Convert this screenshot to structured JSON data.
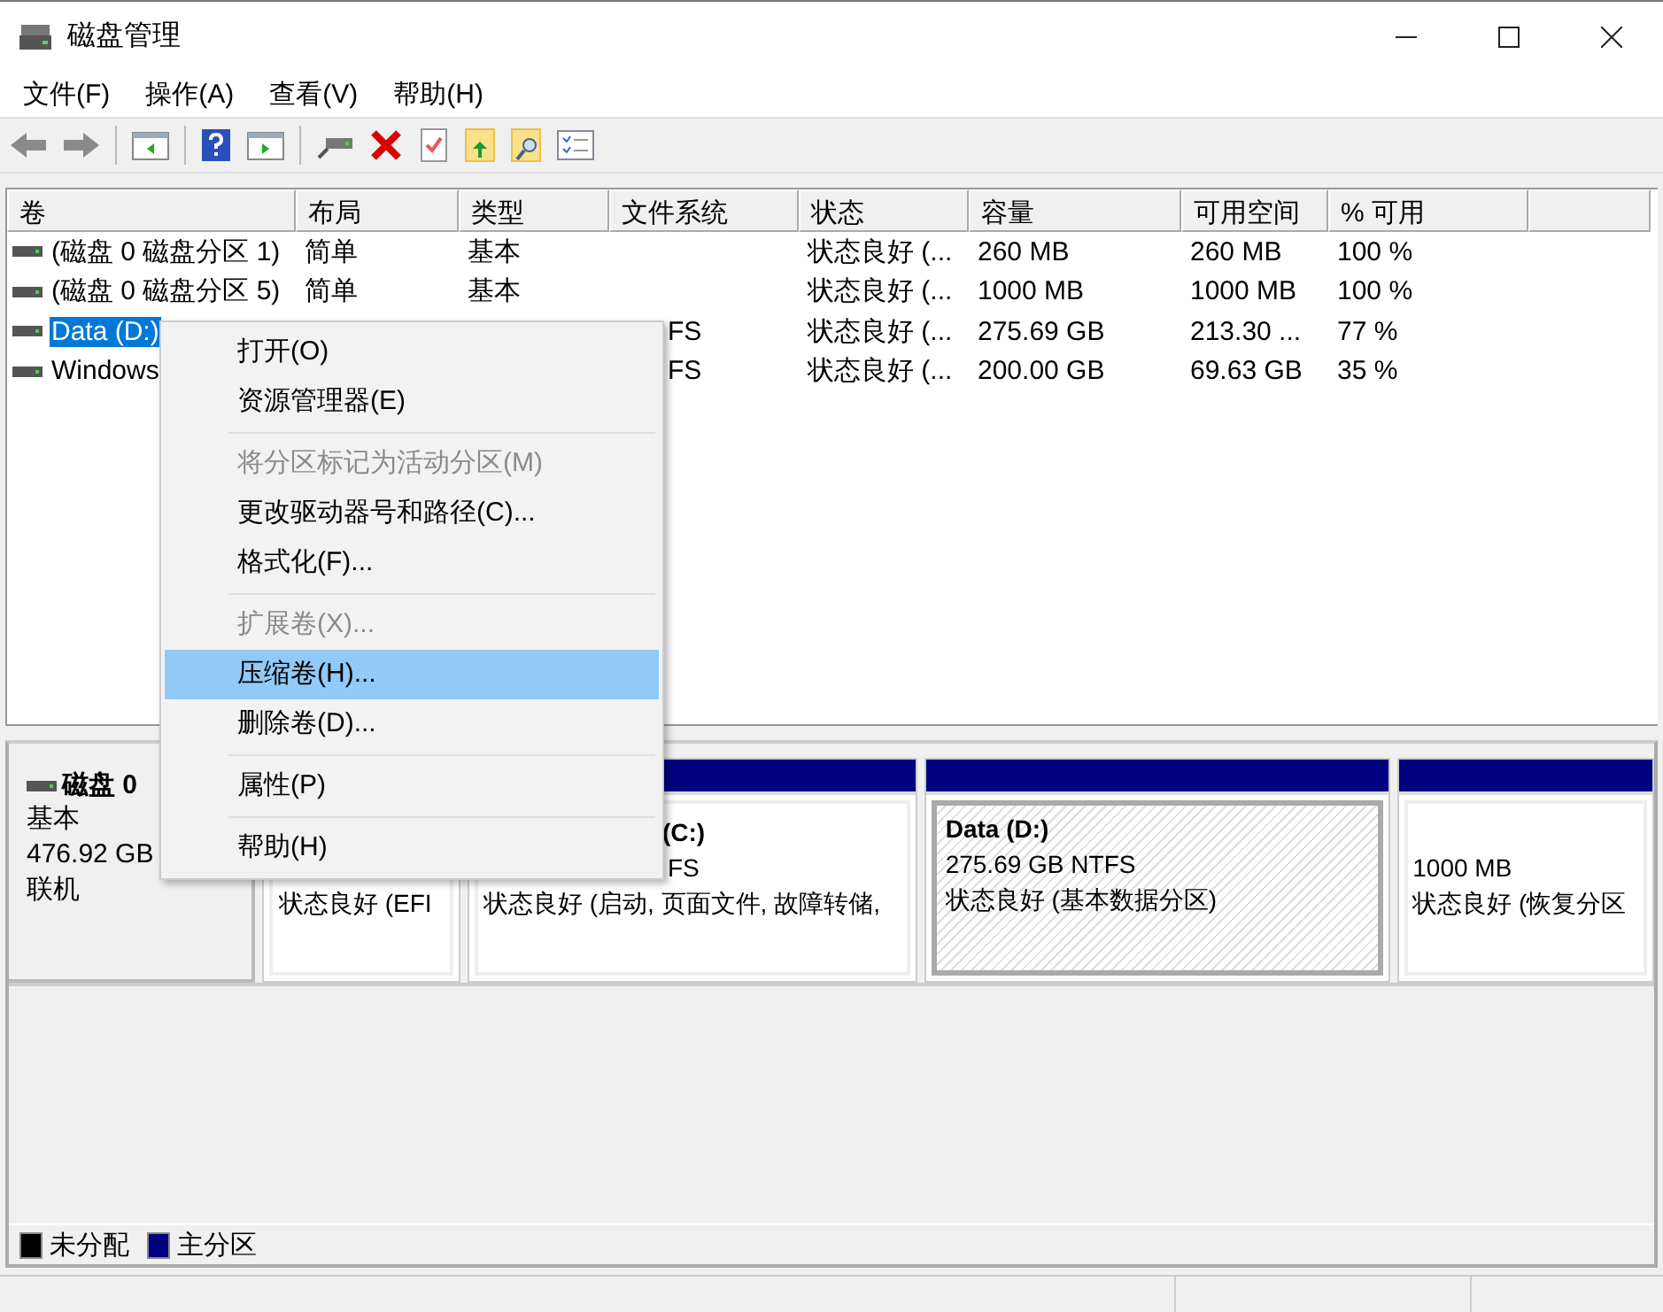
{
  "window": {
    "title": "磁盘管理"
  },
  "menu_bar": [
    "文件(F)",
    "操作(A)",
    "查看(V)",
    "帮助(H)"
  ],
  "table": {
    "columns": [
      "卷",
      "布局",
      "类型",
      "文件系统",
      "状态",
      "容量",
      "可用空间",
      "% 可用"
    ],
    "rows": [
      {
        "volume": "(磁盘 0 磁盘分区 1)",
        "layout": "简单",
        "type": "基本",
        "status": "状态良好 (...",
        "capacity": "260 MB",
        "free_space": "260 MB",
        "percent_free": "100 %",
        "selected": false
      },
      {
        "volume": "(磁盘 0 磁盘分区 5)",
        "layout": "简单",
        "type": "基本",
        "status": "状态良好 (...",
        "capacity": "1000 MB",
        "free_space": "1000 MB",
        "percent_free": "100 %",
        "selected": false
      },
      {
        "volume": "Data (D:)",
        "filesystem": "FS",
        "filesystem_cut": true,
        "status": "状态良好 (...",
        "capacity": "275.69 GB",
        "free_space": "213.30 ...",
        "percent_free": "77 %",
        "selected": true
      },
      {
        "volume": "Windows",
        "filesystem": "FS",
        "filesystem_cut": true,
        "status": "状态良好 (...",
        "capacity": "200.00 GB",
        "free_space": "69.63 GB",
        "percent_free": "35 %",
        "selected": false
      }
    ]
  },
  "disk": {
    "name": "磁盘 0",
    "type": "基本",
    "size": "476.92 GB",
    "state": "联机",
    "partitions": [
      {
        "status": "状态良好 (EFI",
        "selected": false
      },
      {
        "title": "(C:)",
        "size": "FS",
        "status": "状态良好 (启动, 页面文件, 故障转储,",
        "cut": true,
        "selected": false
      },
      {
        "title": "Data  (D:)",
        "size": "275.69 GB NTFS",
        "status": "状态良好 (基本数据分区)",
        "selected": true
      },
      {
        "size": "1000 MB",
        "status": "状态良好 (恢复分区",
        "selected": false
      }
    ]
  },
  "legend": [
    {
      "label": "未分配",
      "color": "#000000"
    },
    {
      "label": "主分区",
      "color": "#000080"
    }
  ],
  "context_menu": [
    {
      "label": "打开(O)",
      "disabled": false,
      "selected": false
    },
    {
      "label": "资源管理器(E)",
      "disabled": false,
      "selected": false,
      "separator_after": true
    },
    {
      "label": "将分区标记为活动分区(M)",
      "disabled": true,
      "selected": false
    },
    {
      "label": "更改驱动器号和路径(C)...",
      "disabled": false,
      "selected": false
    },
    {
      "label": "格式化(F)...",
      "disabled": false,
      "selected": false,
      "separator_after": true
    },
    {
      "label": "扩展卷(X)...",
      "disabled": true,
      "selected": false
    },
    {
      "label": "压缩卷(H)...",
      "disabled": false,
      "selected": true
    },
    {
      "label": "删除卷(D)...",
      "disabled": false,
      "selected": false,
      "separator_after": true
    },
    {
      "label": "属性(P)",
      "disabled": false,
      "selected": false,
      "separator_after": true
    },
    {
      "label": "帮助(H)",
      "disabled": false,
      "selected": false
    }
  ]
}
